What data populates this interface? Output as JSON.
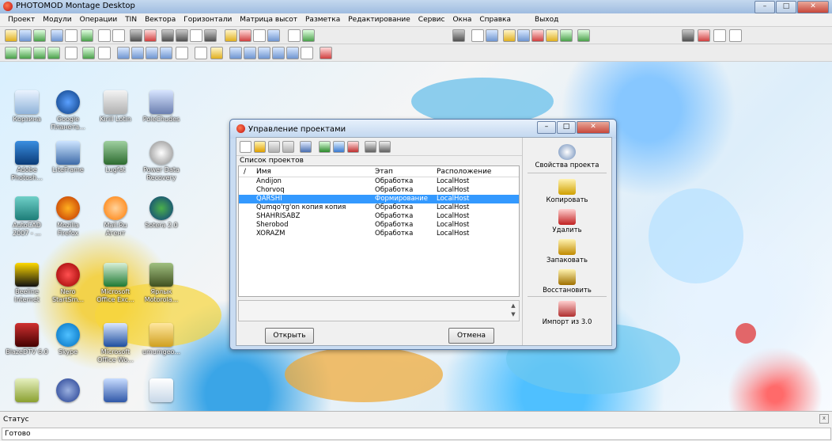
{
  "app": {
    "title": "PHOTOMOD Montage Desktop",
    "window_buttons": [
      "–",
      "□",
      "✕"
    ]
  },
  "menu": [
    "Проект",
    "Модули",
    "Операции",
    "TIN",
    "Вектора",
    "Горизонтали",
    "Матрица высот",
    "Разметка",
    "Редактирование",
    "Сервис",
    "Окна",
    "Справка",
    "Выход"
  ],
  "desktop_icons": [
    {
      "label": "Корзина"
    },
    {
      "label": "Google Планета..."
    },
    {
      "label": "Kirill Lotin"
    },
    {
      "label": "PoleChudes"
    },
    {
      "label": "Adobe Photosh..."
    },
    {
      "label": "LiteFrame"
    },
    {
      "label": "Lugfat"
    },
    {
      "label": "Power Data Recovery"
    },
    {
      "label": "AutoCAD 2007 - ..."
    },
    {
      "label": "Mozilla Firefox"
    },
    {
      "label": "Mail.Ru Агент"
    },
    {
      "label": "Sotera 2.0"
    },
    {
      "label": "Beeline Internet"
    },
    {
      "label": "Nero StartSm..."
    },
    {
      "label": "Microsoft Office Exc..."
    },
    {
      "label": "Ярлык Motorola..."
    },
    {
      "label": "BlazeDTV 6.0"
    },
    {
      "label": "Skype"
    },
    {
      "label": "Microsoft Office Wo..."
    },
    {
      "label": "umumgeo..."
    }
  ],
  "dialog": {
    "title": "Управление проектами",
    "window_buttons": [
      "–",
      "□",
      "✕"
    ],
    "list_caption": "Список проектов",
    "columns": {
      "sort_mark": "/",
      "name": "Имя",
      "stage": "Этап",
      "location": "Расположение"
    },
    "projects": [
      {
        "name": "Andijon",
        "stage": "Обработка",
        "location": "LocalHost"
      },
      {
        "name": "Chorvoq",
        "stage": "Обработка",
        "location": "LocalHost"
      },
      {
        "name": "QARSHI",
        "stage": "Формирование",
        "location": "LocalHost",
        "selected": true
      },
      {
        "name": "Qumqo'rg'on копия копия",
        "stage": "Обработка",
        "location": "LocalHost"
      },
      {
        "name": "SHAHRISABZ",
        "stage": "Обработка",
        "location": "LocalHost"
      },
      {
        "name": "Sherobod",
        "stage": "Обработка",
        "location": "LocalHost"
      },
      {
        "name": "XORAZM",
        "stage": "Обработка",
        "location": "LocalHost"
      }
    ],
    "scroll": {
      "up": "▲",
      "down": "▼"
    },
    "open_label": "Открыть",
    "cancel_label": "Отмена",
    "actions": [
      {
        "label": "Свойства проекта",
        "icon": "info-icon"
      },
      {
        "label": "Копировать",
        "icon": "copy-icon"
      },
      {
        "label": "Удалить",
        "icon": "delete-icon"
      },
      {
        "label": "Запаковать",
        "icon": "pack-icon"
      },
      {
        "label": "Восстановить",
        "icon": "restore-icon"
      },
      {
        "label": "Импорт из 3.0",
        "icon": "import-icon"
      }
    ]
  },
  "status_panel": {
    "label": "Статус",
    "value": "Готово",
    "close": "x"
  }
}
